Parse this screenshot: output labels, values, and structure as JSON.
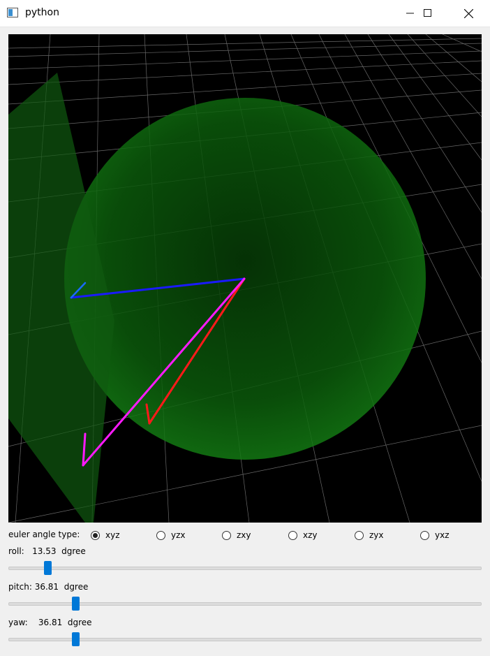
{
  "window": {
    "title": "python",
    "minimize_label": "—",
    "maximize_label": "☐",
    "close_label": "✕"
  },
  "viewport": {
    "background": "#000000",
    "grid_color": "#9a9a9a",
    "sphere_color": "#0a6a0a",
    "plane_color": "#0f4f0f",
    "vectors": [
      {
        "name": "blue-vector",
        "color": "#1a1aff"
      },
      {
        "name": "red-vector",
        "color": "#ff1a1a"
      },
      {
        "name": "magenta-vector",
        "color": "#ff1aff"
      }
    ]
  },
  "euler": {
    "label": "euler angle type:",
    "options": [
      "xyz",
      "yzx",
      "zxy",
      "xzy",
      "zyx",
      "yxz"
    ],
    "selected": "xyz"
  },
  "sliders": {
    "roll": {
      "label": "roll:   13.53  dgree",
      "fraction": 0.04
    },
    "pitch": {
      "label": "pitch: 36.81  dgree",
      "fraction": 0.1
    },
    "yaw": {
      "label": "yaw:    36.81  dgree",
      "fraction": 0.1
    }
  },
  "accent_color": "#0078d7"
}
